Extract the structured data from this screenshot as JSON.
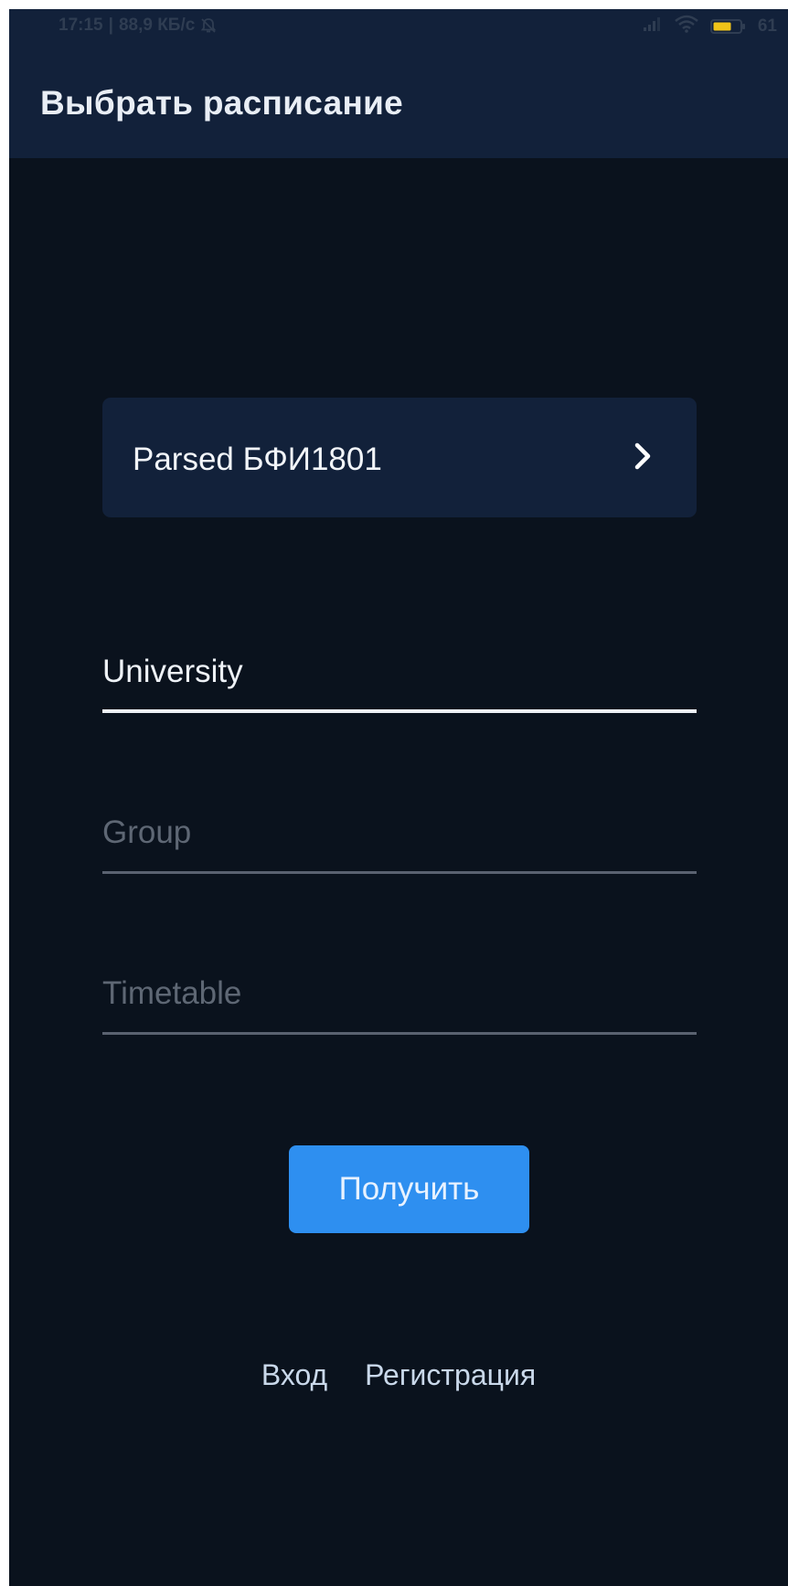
{
  "status_bar": {
    "time": "17:15",
    "network_speed": "88,9 КБ/с",
    "battery_percent": "61",
    "icons": [
      "bell-off-icon",
      "signal-icon",
      "wifi-icon",
      "battery-icon"
    ]
  },
  "app_bar": {
    "title": "Выбрать расписание"
  },
  "saved_schedule": {
    "label": "Parsed БФИ1801",
    "icon": "chevron-right-icon"
  },
  "form": {
    "university": {
      "value": "University",
      "placeholder": "University"
    },
    "group": {
      "value": "",
      "placeholder": "Group"
    },
    "timetable": {
      "value": "",
      "placeholder": "Timetable"
    },
    "submit_label": "Получить"
  },
  "footer_links": {
    "login": "Вход",
    "register": "Регистрация"
  },
  "colors": {
    "background": "#0a121d",
    "header": "#12213a",
    "card": "#12213a",
    "accent": "#2e8ff0",
    "text": "#eef2f7",
    "placeholder": "#5e6774",
    "link": "#c9d8ea"
  }
}
